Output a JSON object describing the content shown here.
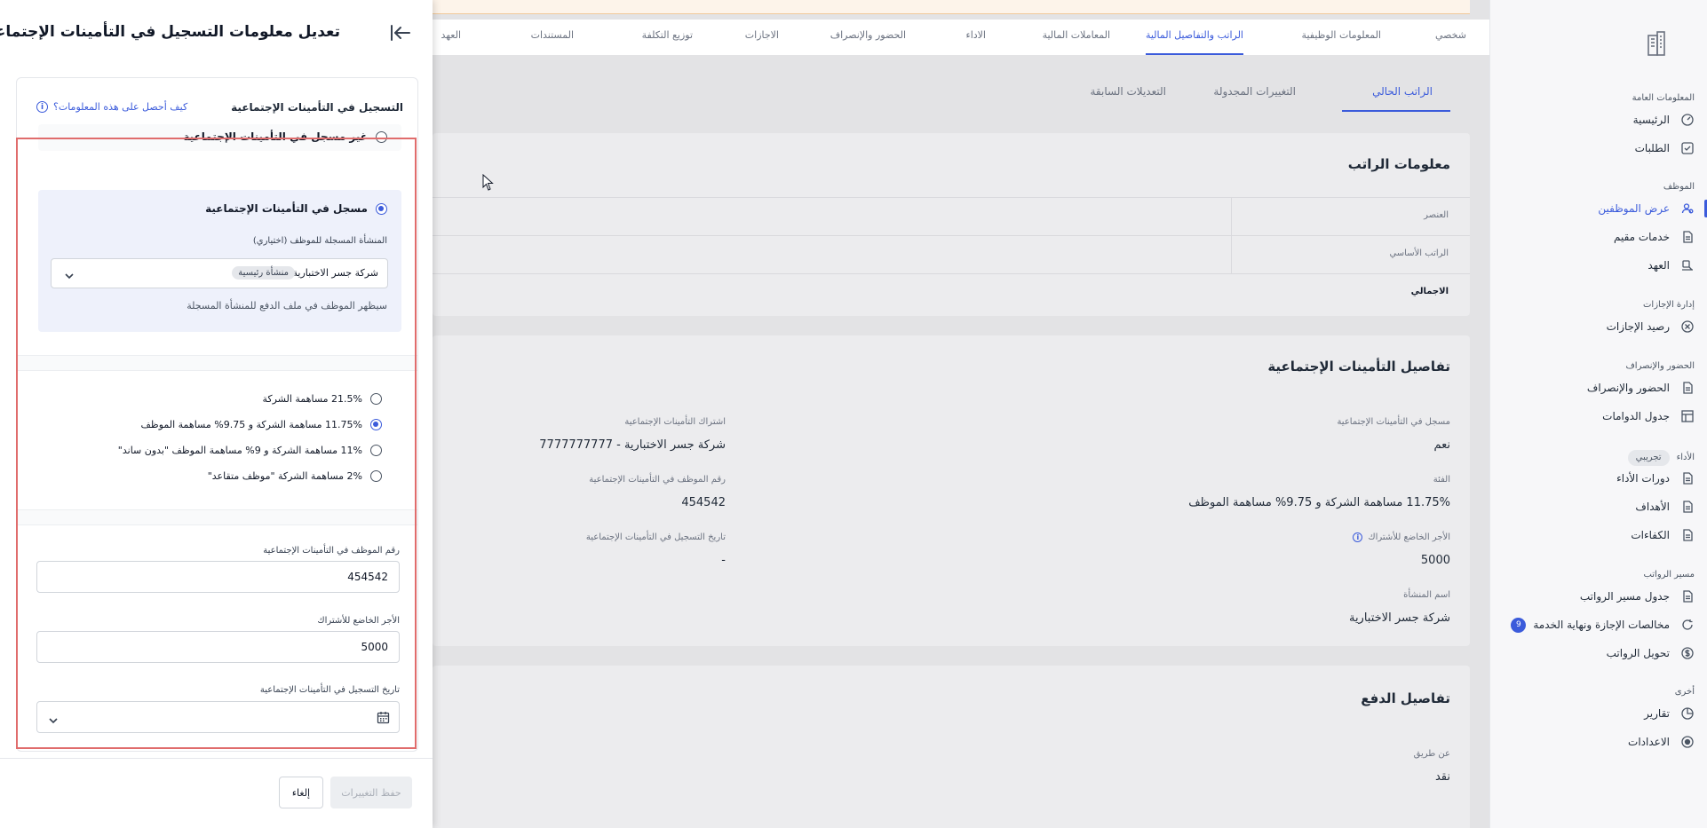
{
  "colors": {
    "accent": "#3b5bdb",
    "highlight_border": "#e06c6c",
    "warning_strip": "#fdf4ea"
  },
  "sidebar": {
    "logo_icon": "building-icon",
    "groups": [
      {
        "title": "المعلومات العامة",
        "items": [
          {
            "label": "الرئيسية",
            "icon": "dashboard-icon"
          },
          {
            "label": "الطلبات",
            "icon": "checkbox-icon"
          }
        ]
      },
      {
        "title": "الموظف",
        "items": [
          {
            "label": "عرض الموظفين",
            "icon": "users-icon",
            "active": true
          },
          {
            "label": "خدمات مقيم",
            "icon": "document-icon"
          },
          {
            "label": "العهد",
            "icon": "custody-icon"
          }
        ]
      },
      {
        "title": "إدارة الإجازات",
        "items": [
          {
            "label": "رصيد الإجازات",
            "icon": "balance-icon"
          }
        ]
      },
      {
        "title": "الحضور والإنصراف",
        "items": [
          {
            "label": "الحضور والإنصراف",
            "icon": "document-icon"
          },
          {
            "label": "جدول الدوامات",
            "icon": "table-icon"
          }
        ]
      },
      {
        "title": "الأداء",
        "pill": "تجريبي",
        "items": [
          {
            "label": "دورات الأداء",
            "icon": "document-icon"
          },
          {
            "label": "الأهداف",
            "icon": "document-icon"
          },
          {
            "label": "الكفاءات",
            "icon": "document-icon"
          }
        ]
      },
      {
        "title": "مسير الرواتب",
        "items": [
          {
            "label": "جدول مسير الرواتب",
            "icon": "document-icon"
          },
          {
            "label": "مخالصات الإجازة ونهاية الخدمة",
            "icon": "refresh-icon",
            "badge": "9"
          },
          {
            "label": "تحويل الرواتب",
            "icon": "dollar-icon"
          }
        ]
      },
      {
        "title": "أخرى",
        "items": [
          {
            "label": "تقارير",
            "icon": "pie-chart-icon"
          },
          {
            "label": "الاعدادات",
            "icon": "settings-icon"
          }
        ]
      }
    ]
  },
  "topnav": {
    "tabs": [
      {
        "label": "شخصي"
      },
      {
        "label": "المعلومات الوظيفية"
      },
      {
        "label": "الراتب والتفاصيل المالية",
        "active": true
      },
      {
        "label": "المعاملات المالية"
      },
      {
        "label": "الاداء"
      },
      {
        "label": "الحضور والإنصراف"
      },
      {
        "label": "الاجازات"
      },
      {
        "label": "توزيع التكلفة"
      },
      {
        "label": "المستندات"
      },
      {
        "label": "العهد"
      }
    ]
  },
  "subtabs": [
    {
      "label": "الراتب الحالي",
      "active": true
    },
    {
      "label": "التغييرات المجدولة"
    },
    {
      "label": "التعديلات السابقة"
    }
  ],
  "salary_card": {
    "title": "معلومات الراتب",
    "header_label": "العنصر",
    "rows": [
      "الراتب الأساسي"
    ],
    "total_label": "الاجمالي"
  },
  "gosi_card": {
    "title": "تفاصيل التأمينات الإجتماعية",
    "fields": {
      "registered_label": "مسجل في التأمينات الإجتماعية",
      "registered_value": "نعم",
      "subscription_label": "اشتراك التأمينات الإجتماعية",
      "subscription_value": "شركة جسر الاختبارية - 7777777777",
      "rate_label": "الفئة",
      "rate_value": "11.75% مساهمة الشركة و 9.75% مساهمة الموظف",
      "emp_no_label": "رقم الموظف في التأمينات الإجتماعية",
      "emp_no_value": "454542",
      "wage_label": "الأجر الخاضع للأشتراك",
      "wage_value": "5000",
      "reg_date_label": "تاريخ التسجيل في التأمينات الإجتماعية",
      "reg_date_value": "-",
      "entity_label": "اسم المنشأة",
      "entity_value": "شركة جسر الاختبارية"
    }
  },
  "payment_card": {
    "title": "تفاصيل الدفع",
    "method_label": "عن طريق",
    "method_value": "نقد"
  },
  "drawer": {
    "title": "تعديل معلومات التسجيل في التأمينات الإجتماعية",
    "collapse_icon": "collapse-arrow-icon",
    "section_title": "التسجيل في التأمينات الإجتماعية",
    "info_link": "كيف أحصل على هذه المعلومات؟",
    "not_registered_label": "غير مسجل في التأمينات الإجتماعية",
    "registered_label": "مسجل في التأمينات الإجتماعية",
    "entity_field_label": "المنشأة المسجلة للموظف (اختياري)",
    "entity_value": "شركة جسر الاختبارية",
    "entity_tag": "منشأة رئيسية",
    "entity_hint": "سيظهر الموظف في ملف الدفع للمنشأة المسجلة",
    "rate_options": [
      {
        "label": "21.5% مساهمة الشركة",
        "checked": false
      },
      {
        "label": "11.75% مساهمة الشركة و 9.75% مساهمة الموظف",
        "checked": true
      },
      {
        "label": "11% مساهمة الشركة و 9% مساهمة الموظف \"بدون ساند\"",
        "checked": false
      },
      {
        "label": "2% مساهمة الشركة \"موظف متقاعد\"",
        "checked": false
      }
    ],
    "emp_no_label": "رقم الموظف في التأمينات الإجتماعية",
    "emp_no_value": "454542",
    "wage_label": "الأجر الخاضع للأشتراك",
    "wage_value": "5000",
    "reg_date_label": "تاريخ التسجيل في التأمينات الإجتماعية",
    "save_label": "حفظ التغييرات",
    "cancel_label": "إلغاء"
  }
}
